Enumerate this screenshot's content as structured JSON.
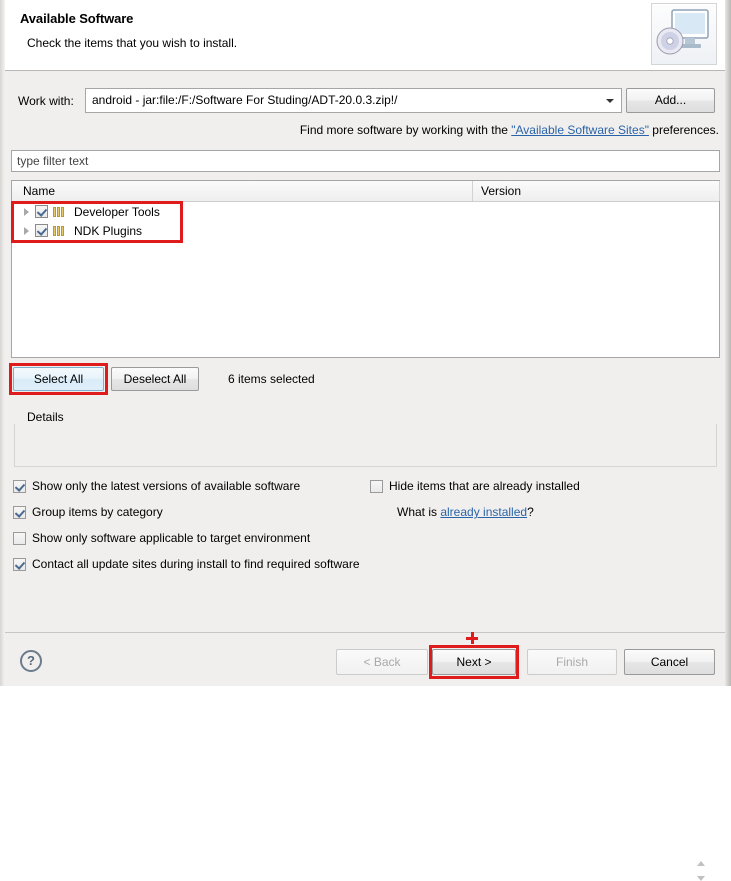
{
  "window": {
    "title": "Available Software",
    "subtitle": "Check the items that you wish to install.",
    "banner_icon": "monitor-with-disc-icon"
  },
  "workwith": {
    "label": "Work with:",
    "value": "android - jar:file:/F:/Software For Studing/ADT-20.0.3.zip!/",
    "dropdown_icon": "chevron-down-icon",
    "add_label": "Add..."
  },
  "findmore": {
    "prefix": "Find more software by working with the ",
    "link": "\"Available Software Sites\"",
    "suffix": " preferences."
  },
  "filter": {
    "placeholder": "type filter text",
    "value": ""
  },
  "tree": {
    "columns": [
      "Name",
      "Version"
    ],
    "rows": [
      {
        "name": "Developer Tools",
        "version": "",
        "checked": true,
        "expandable": true,
        "icon": "category-icon"
      },
      {
        "name": "NDK Plugins",
        "version": "",
        "checked": true,
        "expandable": true,
        "icon": "category-icon"
      }
    ]
  },
  "selection": {
    "select_all_label": "Select All",
    "deselect_all_label": "Deselect All",
    "status": "6 items selected"
  },
  "details": {
    "label": "Details",
    "content": "",
    "spinner_icon": "up-down-arrows-icon"
  },
  "options": {
    "latest": {
      "label": "Show only the latest versions of available software",
      "checked": true
    },
    "group": {
      "label": "Group items by category",
      "checked": true
    },
    "target": {
      "label": "Show only software applicable to target environment",
      "checked": false
    },
    "contact": {
      "label": "Contact all update sites during install to find required software",
      "checked": true
    },
    "hide": {
      "label": "Hide items that are already installed",
      "checked": false
    },
    "whatis_prefix": "What is ",
    "whatis_link": "already installed",
    "whatis_suffix": "?"
  },
  "footer": {
    "help_icon": "help-question-icon",
    "back_label": "< Back",
    "next_label": "Next >",
    "finish_label": "Finish",
    "cancel_label": "Cancel"
  },
  "annotations": {
    "highlight_color": "#e01b1b",
    "cursor_marker": "plus-crosshair"
  }
}
